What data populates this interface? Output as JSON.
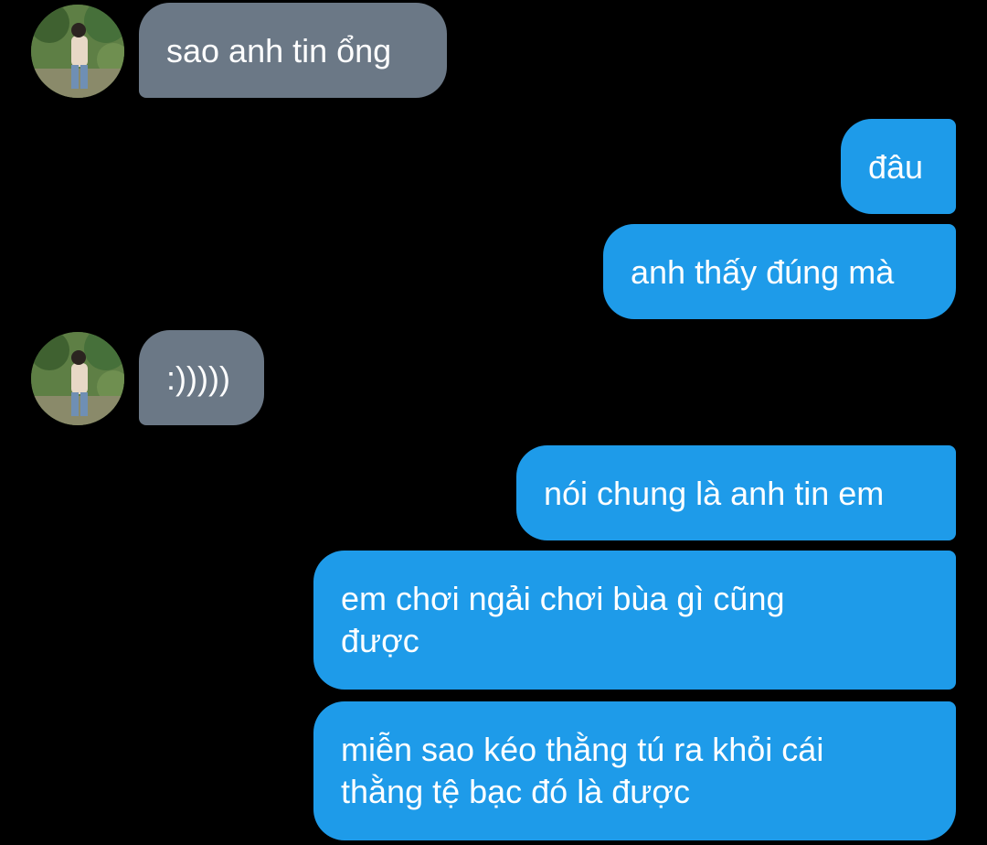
{
  "conversation": {
    "messages": [
      {
        "direction": "incoming",
        "text": "sao anh tin ổng"
      },
      {
        "direction": "outgoing",
        "text": "đâu"
      },
      {
        "direction": "outgoing",
        "text": "anh thấy đúng mà"
      },
      {
        "direction": "incoming",
        "text": ":)))))"
      },
      {
        "direction": "outgoing",
        "text": "nói chung là anh tin em"
      },
      {
        "direction": "outgoing",
        "text": "em chơi ngải chơi bùa gì cũng\nđược"
      },
      {
        "direction": "outgoing",
        "text": "miễn sao kéo thằng tú ra khỏi cái\nthằng tệ bạc đó là được"
      }
    ]
  },
  "colors": {
    "background": "#000000",
    "incoming_bubble": "#6b7886",
    "outgoing_bubble": "#1e9be9",
    "text": "#ffffff"
  },
  "icons": {
    "contact_avatar": "avatar-photo-icon"
  }
}
